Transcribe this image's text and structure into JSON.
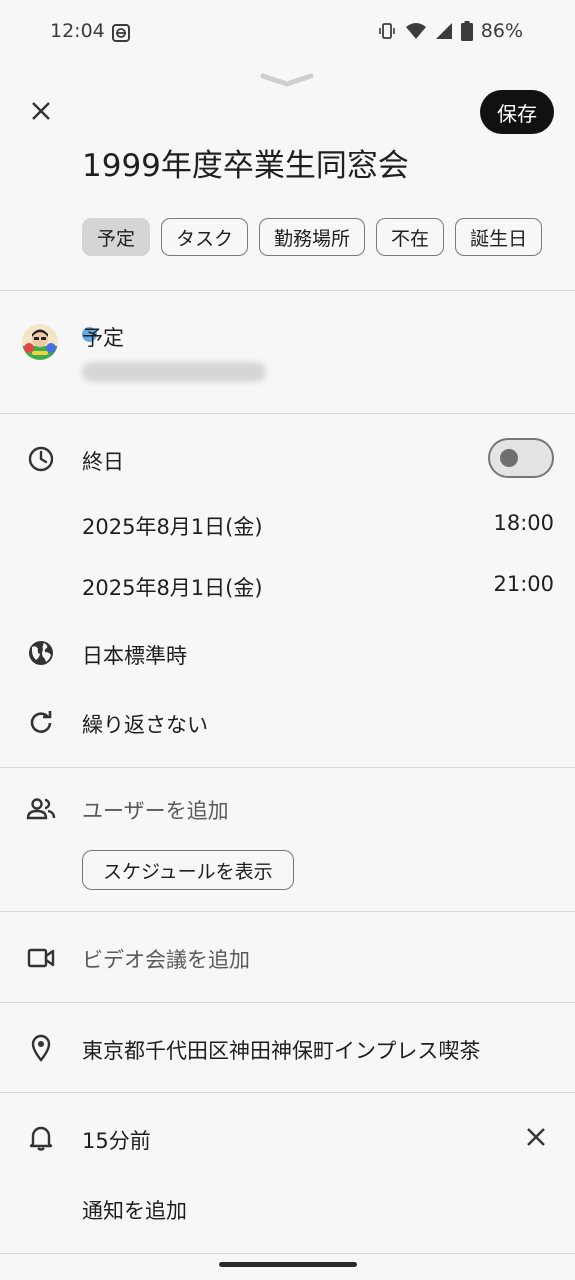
{
  "status_bar": {
    "time": "12:04",
    "battery": "86%",
    "icons": [
      "vpn-icon",
      "vibrate-icon",
      "wifi-icon",
      "signal-icon",
      "battery-icon"
    ]
  },
  "header": {
    "save_label": "保存",
    "title": "1999年度卒業生同窓会"
  },
  "chips": [
    {
      "label": "予定",
      "selected": true
    },
    {
      "label": "タスク",
      "selected": false
    },
    {
      "label": "勤務場所",
      "selected": false
    },
    {
      "label": "不在",
      "selected": false
    },
    {
      "label": "誕生日",
      "selected": false
    }
  ],
  "calendar": {
    "name": "予定",
    "dot_color": "#64a9e6"
  },
  "time_section": {
    "all_day_label": "終日",
    "all_day_on": false,
    "start_date": "2025年8月1日(金)",
    "start_time": "18:00",
    "end_date": "2025年8月1日(金)",
    "end_time": "21:00",
    "timezone": "日本標準時",
    "repeat": "繰り返さない"
  },
  "people": {
    "add_user": "ユーザーを追加",
    "show_schedule": "スケジュールを表示"
  },
  "video": {
    "add_video": "ビデオ会議を追加"
  },
  "location": {
    "text": "東京都千代田区神田神保町インプレス喫茶"
  },
  "notifications": {
    "reminder": "15分前",
    "add_notification": "通知を追加"
  },
  "colors": {
    "background": "#f7f7f7",
    "save_button": "#111111",
    "chip_selected": "#d5d5d5"
  }
}
